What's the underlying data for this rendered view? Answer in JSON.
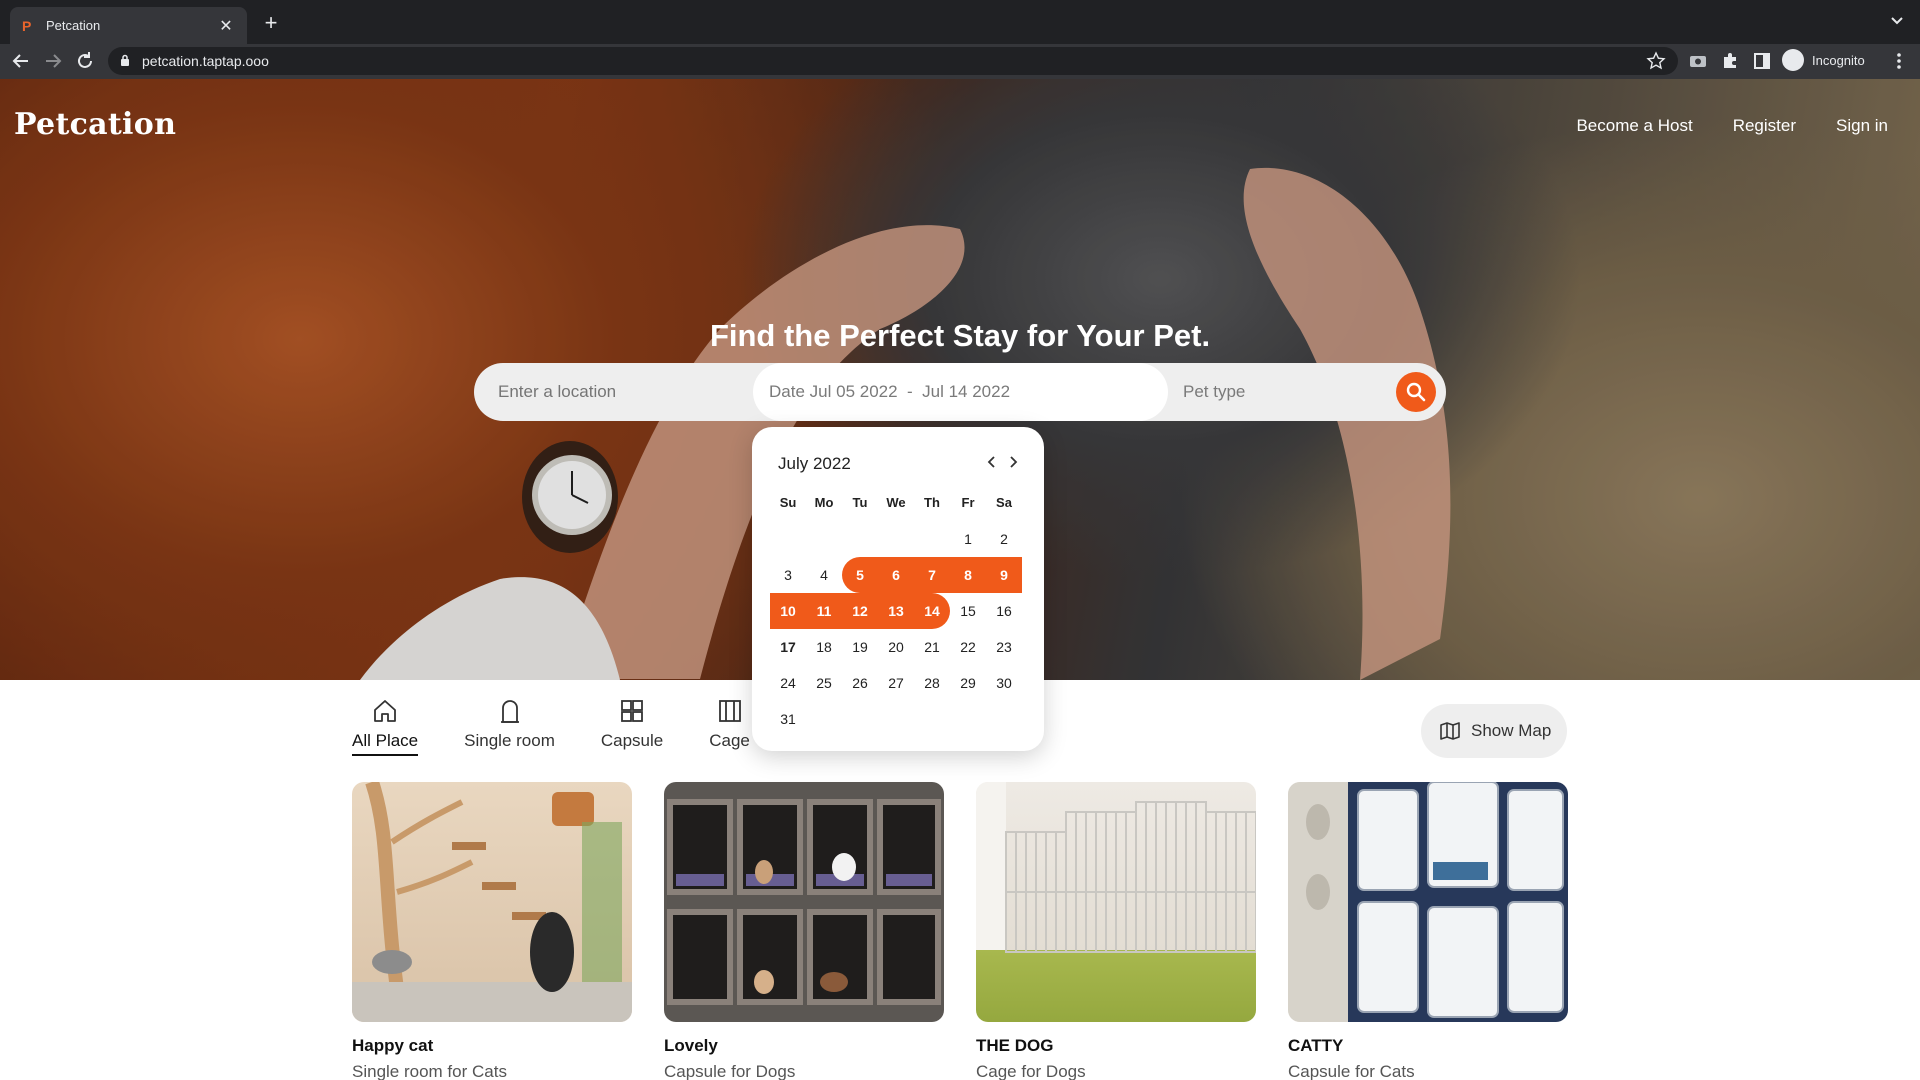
{
  "browser": {
    "tab_title": "Petcation",
    "tab_favicon": "P",
    "url": "petcation.taptap.ooo",
    "profile_label": "Incognito"
  },
  "site": {
    "logo": "Petcation",
    "nav": [
      "Become a Host",
      "Register",
      "Sign in"
    ]
  },
  "hero": {
    "headline": "Find the Perfect Stay for Your Pet."
  },
  "search": {
    "location_placeholder": "Enter a location",
    "date_label": "Date",
    "date_start": "Jul 05 2022",
    "date_sep": "-",
    "date_end": "Jul 14 2022",
    "pet_type_placeholder": "Pet type"
  },
  "calendar": {
    "month_label": "July 2022",
    "weekdays": [
      "Su",
      "Mo",
      "Tu",
      "We",
      "Th",
      "Fr",
      "Sa"
    ],
    "first_weekday_index": 5,
    "days_in_month": 31,
    "range_start": 5,
    "range_end": 14,
    "today": 17
  },
  "categories": {
    "items": [
      {
        "label": "All Place",
        "icon": "home-icon",
        "active": true
      },
      {
        "label": "Single room",
        "icon": "door-icon",
        "active": false
      },
      {
        "label": "Capsule",
        "icon": "grid-icon",
        "active": false
      },
      {
        "label": "Cage",
        "icon": "cage-icon",
        "active": false
      }
    ],
    "show_map_label": "Show Map"
  },
  "cards": [
    {
      "title": "Happy cat",
      "subtitle": "Single room for Cats"
    },
    {
      "title": "Lovely",
      "subtitle": "Capsule for Dogs"
    },
    {
      "title": "THE DOG",
      "subtitle": "Cage for Dogs"
    },
    {
      "title": "CATTY",
      "subtitle": "Capsule for Cats"
    }
  ],
  "colors": {
    "accent": "#f05a1a",
    "chrome_dark": "#202124",
    "chrome_mid": "#35363a"
  }
}
